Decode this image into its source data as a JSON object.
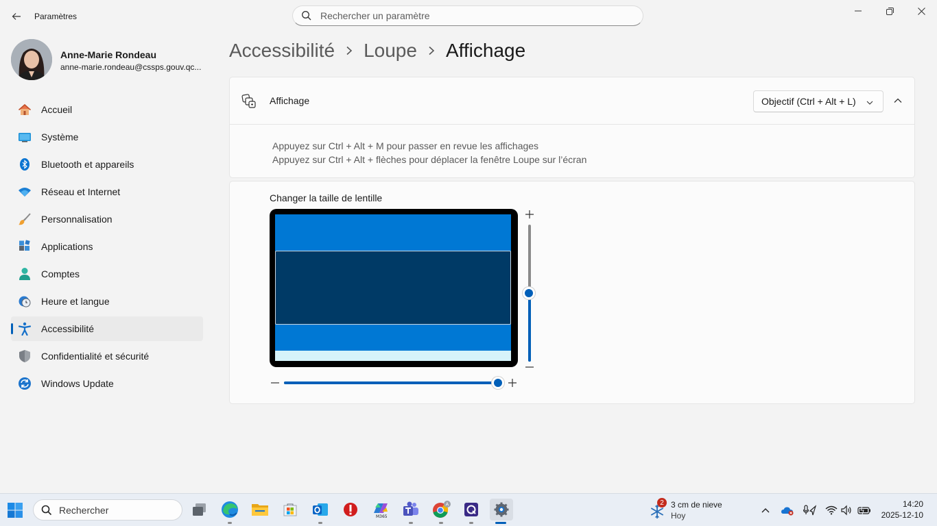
{
  "app": {
    "title": "Paramètres"
  },
  "search": {
    "placeholder": "Rechercher un paramètre"
  },
  "profile": {
    "name": "Anne-Marie Rondeau",
    "email": "anne-marie.rondeau@cssps.gouv.qc..."
  },
  "sidebar": {
    "items": [
      {
        "label": "Accueil",
        "icon": "home-icon"
      },
      {
        "label": "Système",
        "icon": "system-icon"
      },
      {
        "label": "Bluetooth et appareils",
        "icon": "bluetooth-icon"
      },
      {
        "label": "Réseau et Internet",
        "icon": "wifi-icon"
      },
      {
        "label": "Personnalisation",
        "icon": "brush-icon"
      },
      {
        "label": "Applications",
        "icon": "apps-icon"
      },
      {
        "label": "Comptes",
        "icon": "person-icon"
      },
      {
        "label": "Heure et langue",
        "icon": "clock-globe-icon"
      },
      {
        "label": "Accessibilité",
        "icon": "accessibility-icon",
        "active": true
      },
      {
        "label": "Confidentialité et sécurité",
        "icon": "shield-icon"
      },
      {
        "label": "Windows Update",
        "icon": "update-icon"
      }
    ]
  },
  "breadcrumb": {
    "items": [
      "Accessibilité",
      "Loupe"
    ],
    "current": "Affichage"
  },
  "display_card": {
    "label": "Affichage",
    "dropdown_value": "Objectif (Ctrl + Alt + L)",
    "hints": [
      "Appuyez sur Ctrl + Alt + M pour passer en revue les affichages",
      "Appuyez sur Ctrl + Alt + flèches pour déplacer la fenêtre Loupe sur l’écran"
    ]
  },
  "lens_card": {
    "title": "Changer la taille de lentille",
    "height_level": 0.5,
    "width_level": 1.0
  },
  "taskbar": {
    "search_label": "Rechercher",
    "apps": [
      "task-view",
      "edge",
      "file-explorer",
      "microsoft-store",
      "outlook",
      "app-red",
      "microsoft-365",
      "teams",
      "chrome",
      "app-purple",
      "settings"
    ],
    "weather": {
      "title": "3 cm de nieve",
      "subtitle": "Hoy",
      "badge": "2"
    },
    "clock": {
      "time": "14:20",
      "date": "2025-12-10"
    }
  },
  "colors": {
    "accent": "#005fb8",
    "lens_screen": "#0078d4",
    "lens_rect": "#003a66"
  }
}
